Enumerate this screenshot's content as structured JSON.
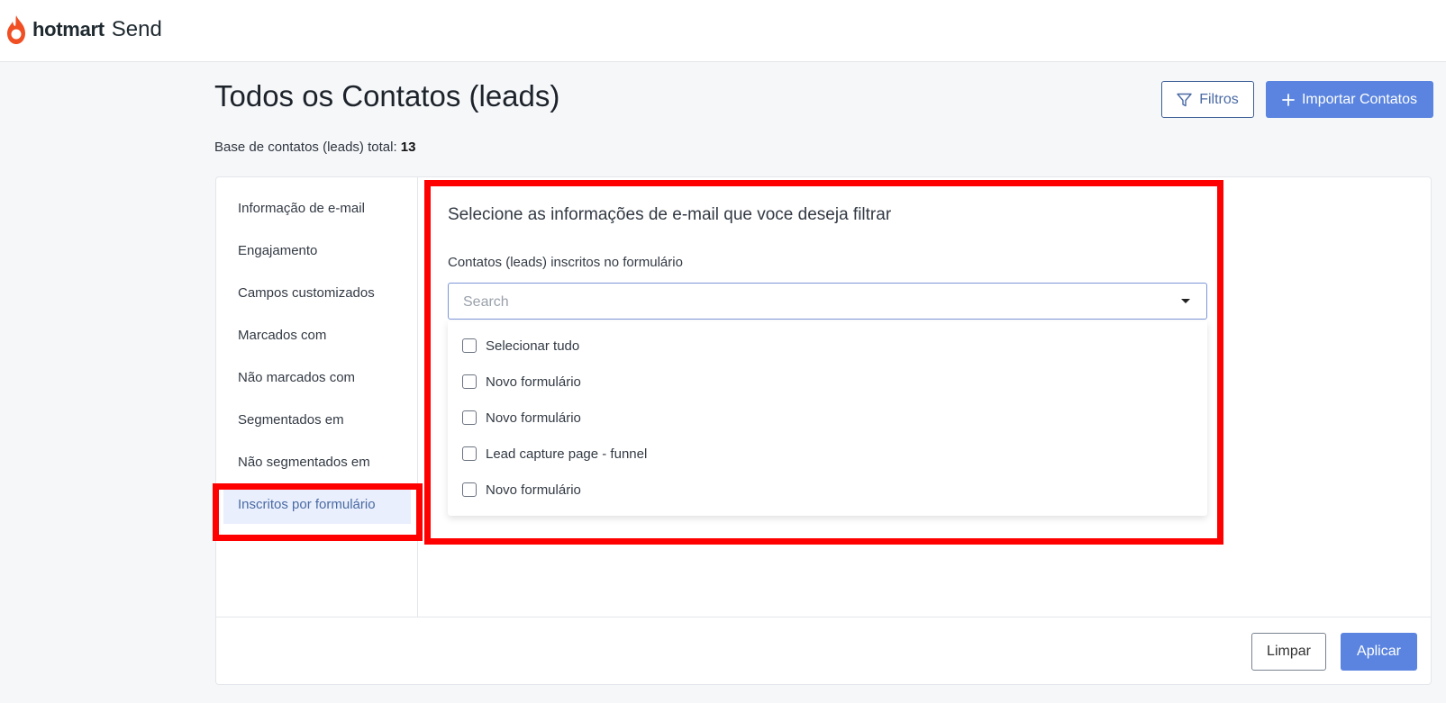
{
  "header": {
    "brand_name": "hotmart",
    "product_name": "Send"
  },
  "page": {
    "title": "Todos os Contatos (leads)",
    "total_label": "Base de contatos (leads) total:",
    "total_value": "13",
    "filters_button": "Filtros",
    "import_button": "Importar Contatos"
  },
  "sidebar": {
    "items": [
      {
        "label": "Informação de e-mail"
      },
      {
        "label": "Engajamento"
      },
      {
        "label": "Campos customizados"
      },
      {
        "label": "Marcados com"
      },
      {
        "label": "Não marcados com"
      },
      {
        "label": "Segmentados em"
      },
      {
        "label": "Não segmentados em"
      },
      {
        "label": "Inscritos por formulário",
        "active": true
      }
    ]
  },
  "panel": {
    "title": "Selecione as informações de e-mail que voce deseja filtrar",
    "field_label": "Contatos (leads) inscritos no formulário",
    "search_placeholder": "Search",
    "options": [
      {
        "label": "Selecionar tudo",
        "checked": false
      },
      {
        "label": "Novo formulário",
        "checked": false
      },
      {
        "label": "Novo formulário",
        "checked": false
      },
      {
        "label": "Lead capture page - funnel",
        "checked": false
      },
      {
        "label": "Novo formulário",
        "checked": false
      }
    ]
  },
  "footer": {
    "clear_button": "Limpar",
    "apply_button": "Aplicar"
  },
  "colors": {
    "primary": "#5a84e0",
    "highlight": "#ff0000",
    "brand_flame": "#f04e23"
  },
  "icons": {
    "brand": "hotmart-flame-icon",
    "filter": "funnel-icon",
    "import": "plus-icon",
    "dropdown": "caret-down-icon"
  }
}
